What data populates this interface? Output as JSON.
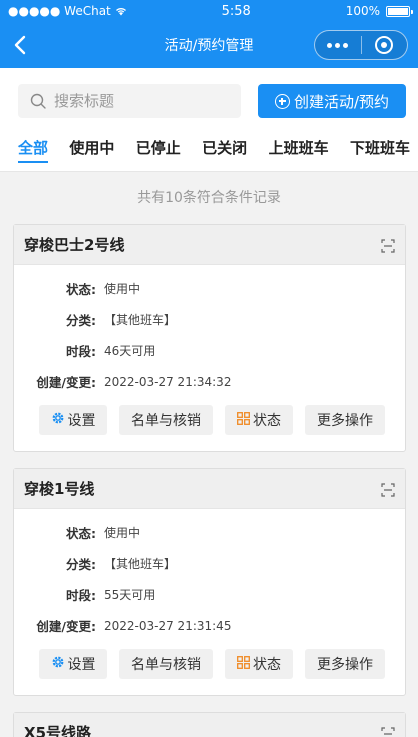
{
  "status_bar": {
    "carrier": "●●●●● WeChat",
    "time": "5:58",
    "battery": "100%"
  },
  "nav": {
    "title": "活动/预约管理"
  },
  "search": {
    "placeholder": "搜索标题",
    "value": ""
  },
  "create_button": {
    "label": "创建活动/预约"
  },
  "tabs": [
    {
      "label": "全部",
      "active": true
    },
    {
      "label": "使用中",
      "active": false
    },
    {
      "label": "已停止",
      "active": false
    },
    {
      "label": "已关闭",
      "active": false
    },
    {
      "label": "上班班车",
      "active": false
    },
    {
      "label": "下班班车",
      "active": false
    }
  ],
  "summary": "共有10条符合条件记录",
  "labels": {
    "status": "状态:",
    "category": "分类:",
    "period": "时段:",
    "created": "创建/变更:"
  },
  "actions": {
    "settings": "设置",
    "roster": "名单与核销",
    "status": "状态",
    "more": "更多操作"
  },
  "cards": [
    {
      "title": "穿梭巴士2号线",
      "status": "使用中",
      "category": "【其他班车】",
      "period": "46天可用",
      "created": "2022-03-27 21:34:32"
    },
    {
      "title": "穿梭1号线",
      "status": "使用中",
      "category": "【其他班车】",
      "period": "55天可用",
      "created": "2022-03-27 21:31:45"
    },
    {
      "title": "X5号线路"
    }
  ],
  "colors": {
    "primary": "#1a8ff3",
    "settings_icon": "#1a8ff3",
    "status_icon": "#f08a24"
  }
}
